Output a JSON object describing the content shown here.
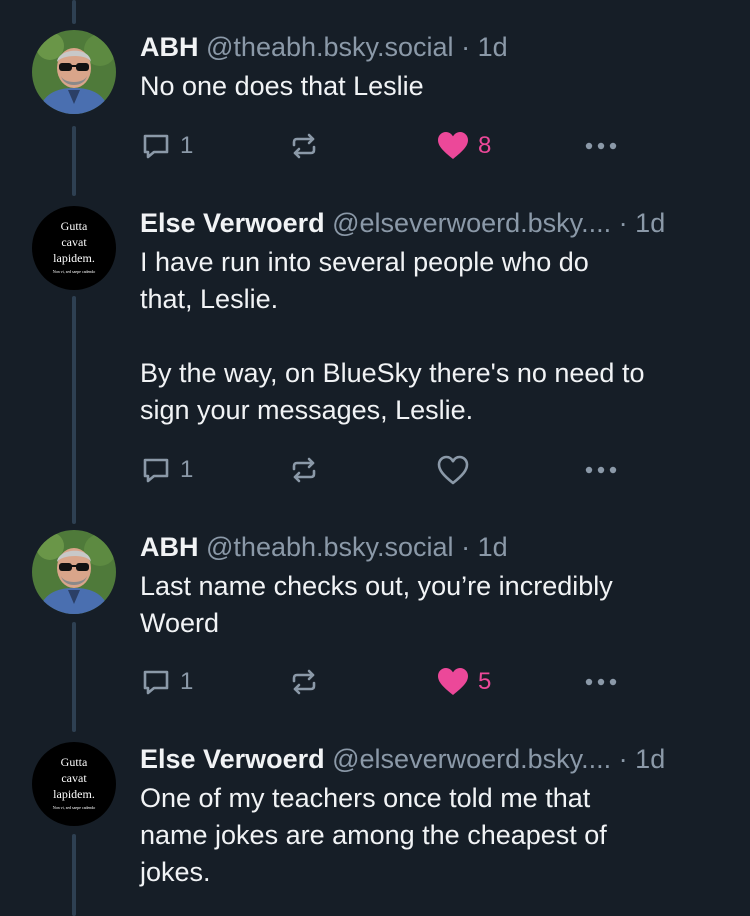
{
  "posts": [
    {
      "name": "ABH",
      "handle": "@theabh.bsky.social",
      "separator": "·",
      "time": "1d",
      "avatar": "photo-avatar",
      "lines": [
        "No one does that Leslie"
      ],
      "reply_count": "1",
      "like_count": "8",
      "liked": true
    },
    {
      "name": "Else Verwoerd",
      "handle": "@elseverwoerd.bsky....",
      "separator": "·",
      "time": "1d",
      "avatar": "text-avatar",
      "lines": [
        "I have run into several people who do",
        "that, Leslie.",
        "",
        "By the way, on BlueSky there's no need to",
        "sign your messages, Leslie."
      ],
      "reply_count": "1",
      "like_count": "",
      "liked": false
    },
    {
      "name": "ABH",
      "handle": "@theabh.bsky.social",
      "separator": "·",
      "time": "1d",
      "avatar": "photo-avatar",
      "lines": [
        "Last name checks out, you’re incredibly",
        "Woerd"
      ],
      "reply_count": "1",
      "like_count": "5",
      "liked": true
    },
    {
      "name": "Else Verwoerd",
      "handle": "@elseverwoerd.bsky....",
      "separator": "·",
      "time": "1d",
      "avatar": "text-avatar",
      "lines": [
        "One of my teachers once told me that",
        "name jokes are among the cheapest of",
        "jokes."
      ],
      "reply_count": "",
      "like_count": "",
      "liked": false
    }
  ],
  "text_avatar": {
    "line1": "Gutta",
    "line2": "cavat",
    "line3": "lapidem.",
    "line4": "Non vi, sed saepe cadendo"
  },
  "colors": {
    "background": "#161e27",
    "muted": "#8b99a8",
    "like": "#ec4899",
    "thread": "#2e4052"
  }
}
